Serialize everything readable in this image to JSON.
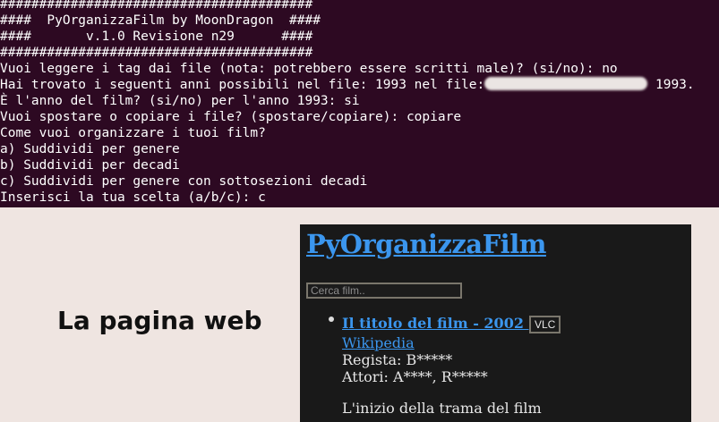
{
  "terminal": {
    "lines": [
      "########################################",
      "####  PyOrganizzaFilm by MoonDragon  ####",
      "####       v.1.0 Revisione n29      ####",
      "########################################",
      "Vuoi leggere i tag dai file (nota: potrebbero essere scritti male)? (si/no): no",
      "Hai trovato i seguenti anni possibili nel file: 1993 nel file:",
      "È l'anno del film? (si/no) per l'anno 1993: si",
      "Vuoi spostare o copiare i file? (spostare/copiare): copiare",
      "Come vuoi organizzare i tuoi film?",
      "a) Suddividi per genere",
      "b) Suddividi per decadi",
      "c) Suddividi per genere con sottosezioni decadi",
      "Inserisci la tua scelta (a/b/c): c"
    ],
    "line6_suffix": " 1993."
  },
  "caption": "La pagina web",
  "webpage": {
    "title": "PyOrganizzaFilm",
    "search_placeholder": "Cerca film..",
    "film": {
      "title": "Il titolo del film - 2002 ",
      "vlc_label": "VLC",
      "wikipedia_label": "Wikipedia",
      "director": "Regista: B*****",
      "actors": "Attori: A****, R*****",
      "plot": "L'inizio della trama del film"
    }
  },
  "colors": {
    "terminal_bg": "#2d0922",
    "page_bg": "#efe5e1",
    "web_bg": "#191919",
    "link": "#3b96ee"
  }
}
